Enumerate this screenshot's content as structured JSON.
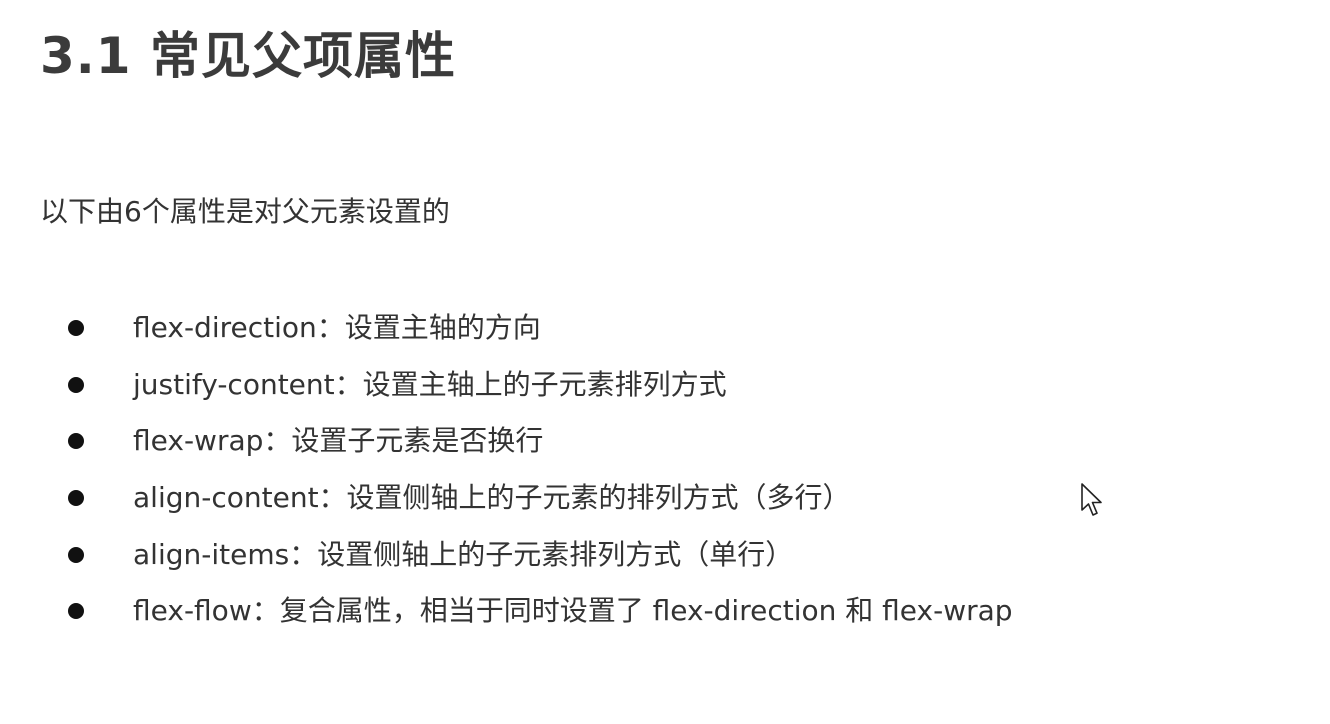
{
  "title": "3.1 常见父项属性",
  "intro": "以下由6个属性是对父元素设置的",
  "properties": [
    {
      "text": "flex-direction：设置主轴的方向"
    },
    {
      "text": "justify-content：设置主轴上的子元素排列方式"
    },
    {
      "text": "flex-wrap：设置子元素是否换行"
    },
    {
      "text": "align-content：设置侧轴上的子元素的排列方式（多行）"
    },
    {
      "text": "align-items：设置侧轴上的子元素排列方式（单行）"
    },
    {
      "text": "flex-flow：复合属性，相当于同时设置了 flex-direction 和 flex-wrap"
    }
  ],
  "icons": {
    "bullet": "filled-circle",
    "cursor": "mouse-pointer-icon"
  }
}
